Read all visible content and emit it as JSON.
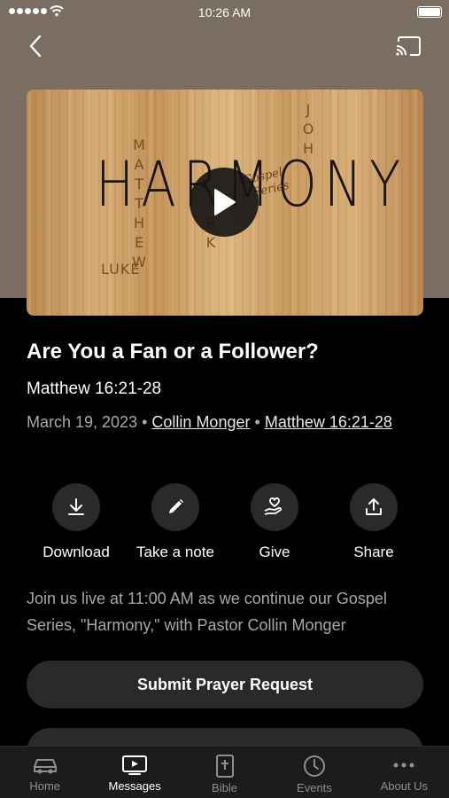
{
  "status_bar": {
    "time": "10:26 AM"
  },
  "thumbnail": {
    "title_text": "HARMONY",
    "gospel_line1": "Gospel",
    "gospel_line2": "Series",
    "words": {
      "matthew": "MATTHEW",
      "luke": "LUKE",
      "mark": "RK",
      "john": "JOH"
    }
  },
  "sermon": {
    "title": "Are You a Fan or a Follower?",
    "scripture": "Matthew 16:21-28",
    "date": "March 19, 2023",
    "separator": "•",
    "speaker": "Collin Monger",
    "scripture_link": "Matthew 16:21-28"
  },
  "actions": [
    {
      "label": "Download",
      "icon": "download-icon"
    },
    {
      "label": "Take a note",
      "icon": "pencil-icon"
    },
    {
      "label": "Give",
      "icon": "heart-hand-icon"
    },
    {
      "label": "Share",
      "icon": "share-icon"
    }
  ],
  "description": "Join us live at 11:00 AM as we continue our Gospel Series, \"Harmony,\" with Pastor Collin Monger",
  "prayer_button": "Submit Prayer Request",
  "tabs": [
    {
      "label": "Home",
      "icon": "car-icon",
      "active": false
    },
    {
      "label": "Messages",
      "icon": "tv-icon",
      "active": true
    },
    {
      "label": "Bible",
      "icon": "bible-icon",
      "active": false
    },
    {
      "label": "Events",
      "icon": "clock-icon",
      "active": false
    },
    {
      "label": "About Us",
      "icon": "more-icon",
      "active": false
    }
  ],
  "colors": {
    "background": "#000000",
    "hero": "#7a6e63",
    "button": "#2a2a2a",
    "tabbar": "#1c1c1e"
  }
}
